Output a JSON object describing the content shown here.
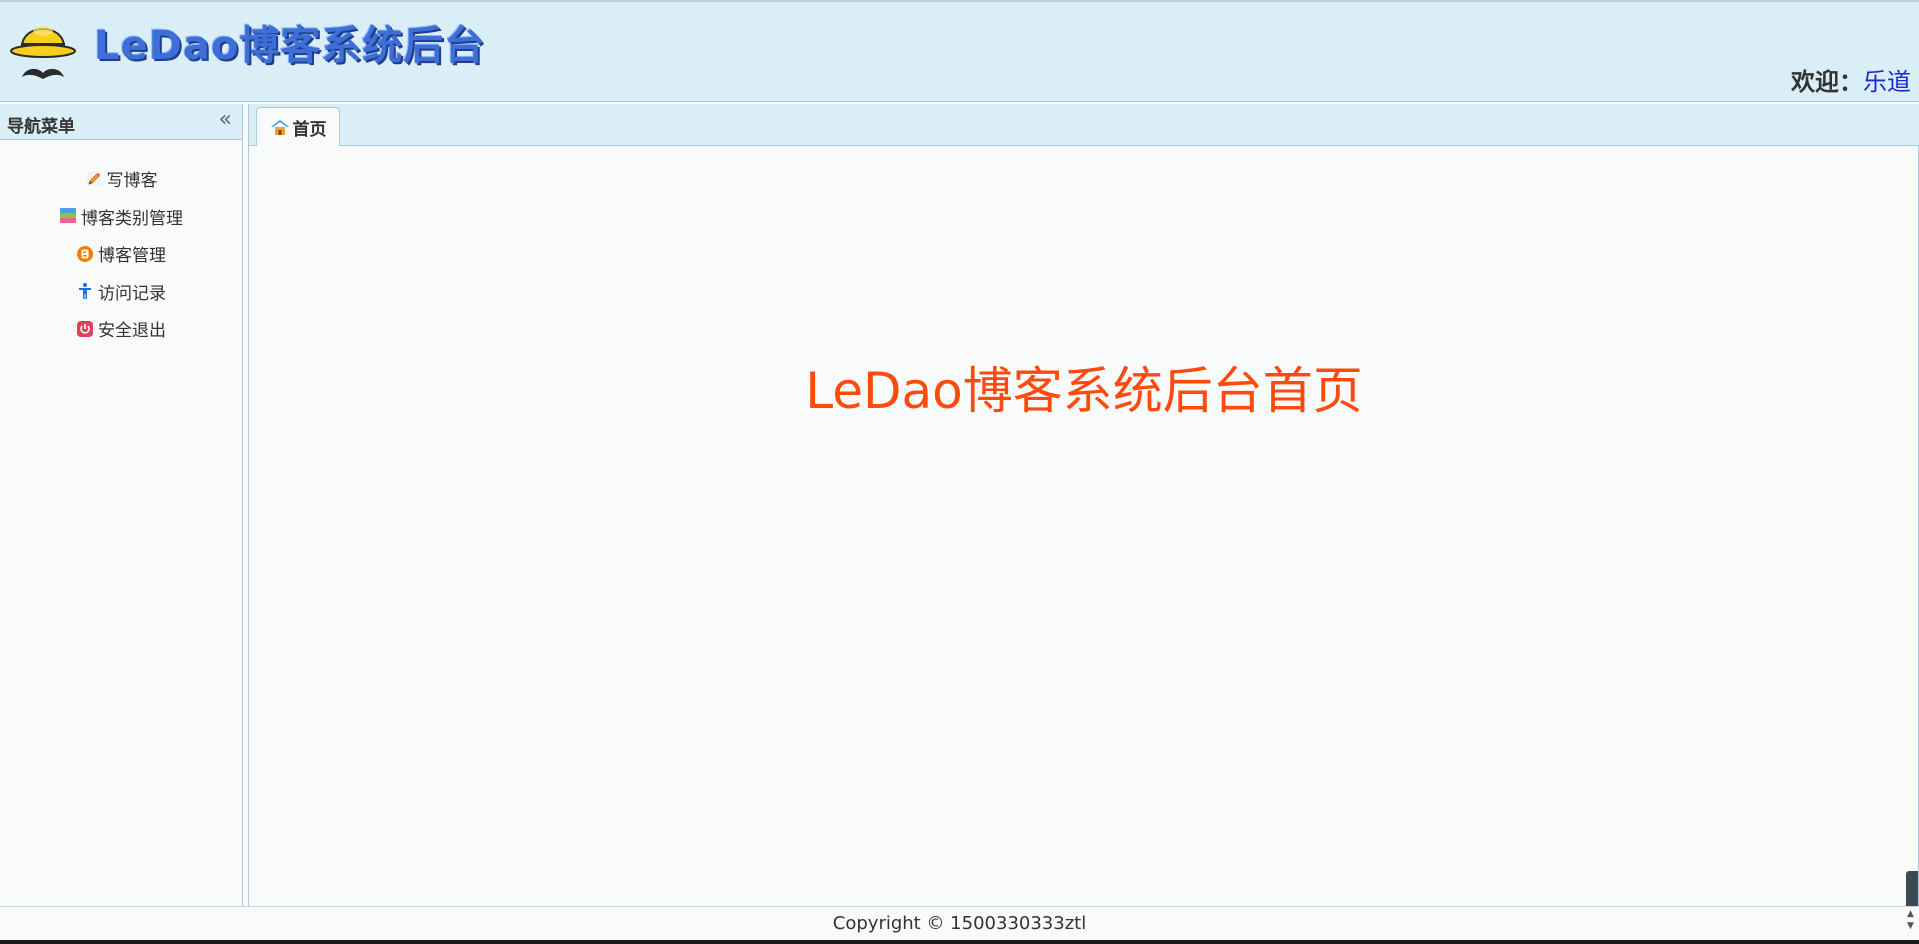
{
  "header": {
    "logo_text": "LeDao博客系统后台",
    "welcome_label": "欢迎：",
    "username": "乐道"
  },
  "sidebar": {
    "title": "导航菜单",
    "items": [
      {
        "label": "写博客",
        "icon": "pencil-icon"
      },
      {
        "label": "博客类别管理",
        "icon": "category-icon"
      },
      {
        "label": "博客管理",
        "icon": "blogger-icon"
      },
      {
        "label": "访问记录",
        "icon": "person-icon"
      },
      {
        "label": "安全退出",
        "icon": "power-icon"
      }
    ]
  },
  "tabs": [
    {
      "label": "首页",
      "icon": "home-icon",
      "active": true
    }
  ],
  "main": {
    "heading": "LeDao博客系统后台首页"
  },
  "footer": {
    "copyright": "Copyright © 1500330333ztl"
  },
  "colors": {
    "header_bg": "#d9eef6",
    "border": "#a9cbdc",
    "heading_color": "#ff4a0d",
    "username_color": "#1a2bd6"
  }
}
